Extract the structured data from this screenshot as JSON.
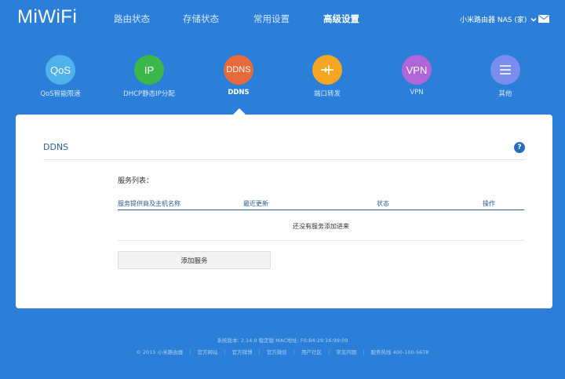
{
  "header": {
    "logo": "MiWiFi",
    "nav": [
      {
        "label": "路由状态",
        "active": false
      },
      {
        "label": "存储状态",
        "active": false
      },
      {
        "label": "常用设置",
        "active": false
      },
      {
        "label": "高级设置",
        "active": true
      }
    ],
    "router_name": "小米路由器 NAS (家)"
  },
  "tools": [
    {
      "icon_text": "QoS",
      "label": "QoS智能限速",
      "color": "#4fb2ea",
      "active": false
    },
    {
      "icon_text": "IP",
      "label": "DHCP静态IP分配",
      "color": "#3cb84a",
      "active": false
    },
    {
      "icon_text": "DDNS",
      "label": "DDNS",
      "color": "#e66a3a",
      "active": true
    },
    {
      "icon_text": "",
      "label": "端口转发",
      "color": "#f5a623",
      "active": false
    },
    {
      "icon_text": "VPN",
      "label": "VPN",
      "color": "#b065d8",
      "active": false
    },
    {
      "icon_text": "",
      "label": "其他",
      "color": "#7c8df0",
      "active": false
    }
  ],
  "card": {
    "title": "DDNS",
    "help": "?",
    "list_label": "服务列表：",
    "columns": [
      "服务提供商及主机名称",
      "最近更新",
      "状态",
      "操作"
    ],
    "empty_message": "还没有服务添加进来",
    "add_button": "添加服务"
  },
  "footer": {
    "version": "系统版本: 2.14.9 稳定版   MAC地址: F0:B4:29:16:99:09",
    "links": [
      "© 2015 小米路由器",
      "官方网站",
      "官方微博",
      "官方微信",
      "用户社区",
      "常见问题",
      "服务热线 400-100-5678"
    ]
  }
}
